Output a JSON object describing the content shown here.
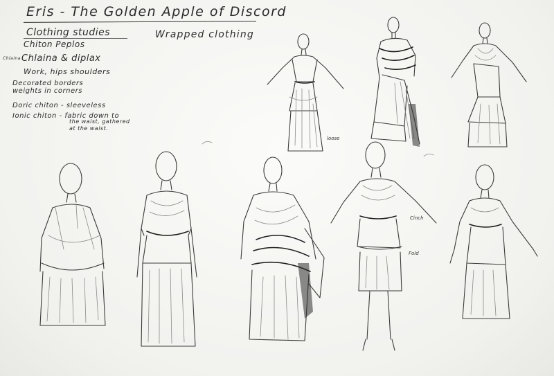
{
  "title": "Eris - The Golden Apple of Discord",
  "notes": {
    "clothing_studies": "Clothing studies",
    "chiton_peplos": "Chiton   Peplos",
    "chlaina_prefix": "Chlaina",
    "chlaina_main": "Chlaina & diplax",
    "work_hips": "Work, hips      shoulders",
    "decorated_borders": "Decorated borders",
    "weights": "weights in corners",
    "doric": "Doric chiton - sleeveless",
    "ionic": "Ionic chiton - fabric down to",
    "ionic_2": "the waist, gathered",
    "ionic_3": "at the waist."
  },
  "wrapped_clothing": "Wrapped clothing",
  "figure_labels": {
    "loose": "loose",
    "cinch": "Cinch",
    "fold": "Fold"
  }
}
